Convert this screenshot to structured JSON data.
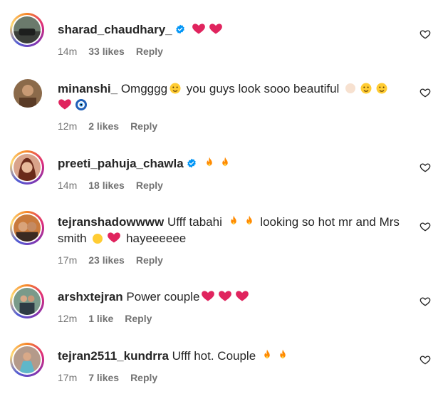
{
  "comments": [
    {
      "username": "sharad_chaudhary_",
      "verified": true,
      "text_before": "",
      "text_after": "",
      "emojis": [
        "red-heart",
        "red-heart"
      ],
      "time": "14m",
      "likes": "33 likes",
      "reply": "Reply"
    },
    {
      "username": "minanshi_",
      "verified": false,
      "text_a": "Omgggg",
      "text_b": "you guys look sooo beautiful",
      "time": "12m",
      "likes": "2 likes",
      "reply": "Reply"
    },
    {
      "username": "preeti_pahuja_chawla",
      "verified": true,
      "time": "14m",
      "likes": "18 likes",
      "reply": "Reply"
    },
    {
      "username": "tejranshadowwww",
      "verified": false,
      "text_a": "Ufff tabahi",
      "text_b": "looking so hot mr and Mrs smith",
      "text_c": "hayeeeeee",
      "time": "17m",
      "likes": "23 likes",
      "reply": "Reply"
    },
    {
      "username": "arshxtejran",
      "verified": false,
      "text_a": "Power couple",
      "time": "12m",
      "likes": "1 like",
      "reply": "Reply"
    },
    {
      "username": "tejran2511_kundrra",
      "verified": false,
      "text_a": "Ufff hot. Couple",
      "time": "17m",
      "likes": "7 likes",
      "reply": "Reply"
    }
  ],
  "colors": {
    "text": "#262626",
    "meta": "#737373",
    "verified": "#0095f6",
    "heart": "#e0245e",
    "fire": "#ff8a00"
  }
}
